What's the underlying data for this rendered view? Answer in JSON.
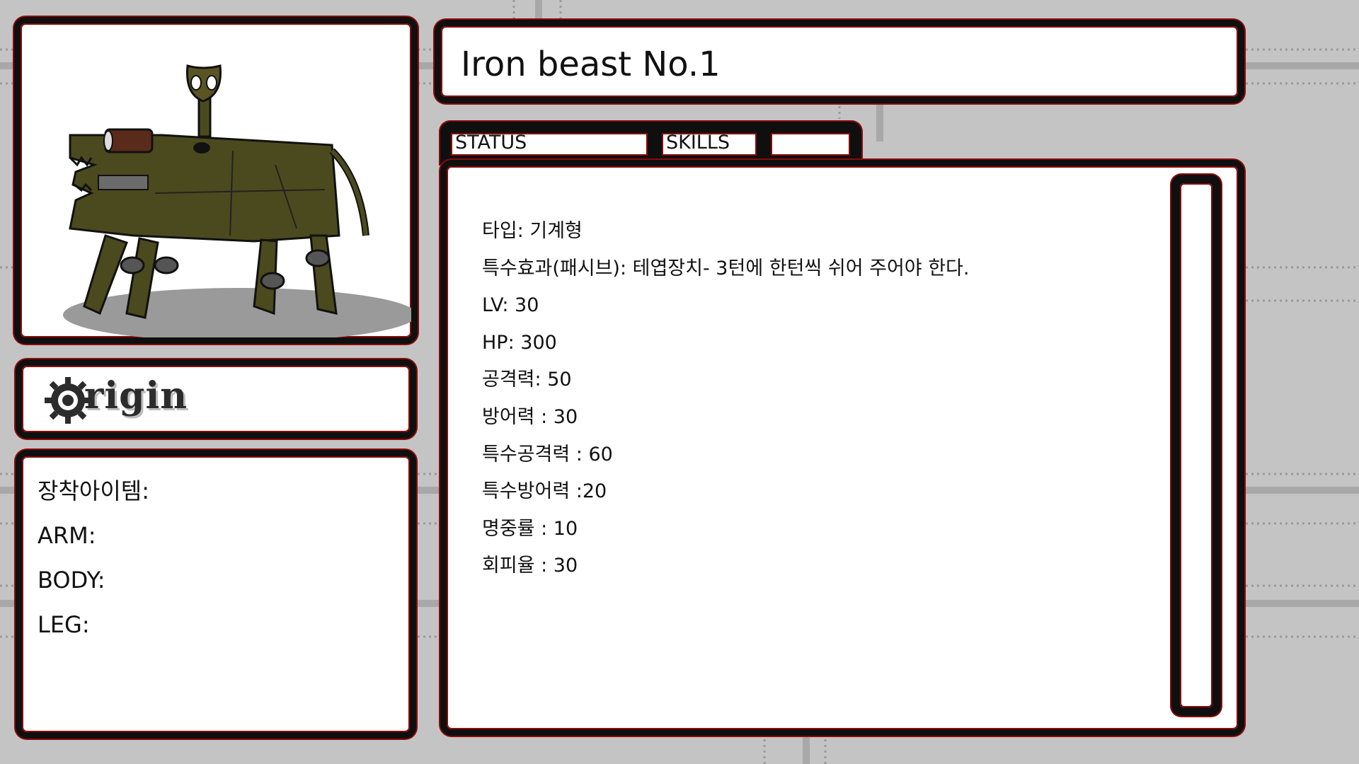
{
  "monster": {
    "name": "Iron beast No.1"
  },
  "tabs": [
    {
      "label": "STATUS"
    },
    {
      "label": "SKILLS"
    },
    {
      "label": ""
    }
  ],
  "stats": [
    "타입: 기계형",
    "특수효과(패시브): 테엽장치- 3턴에 한턴씩 쉬어 주어야 한다.",
    "LV: 30",
    "HP: 300",
    "공격력: 50",
    "방어력 : 30",
    "특수공격력 : 60",
    "특수방어력 :20",
    "명중률 : 10",
    "회피율 : 30"
  ],
  "equipment": {
    "heading": "장착아이템:",
    "slots": [
      "ARM:",
      "BODY:",
      "LEG:"
    ]
  },
  "logo": {
    "text": "rigin"
  },
  "colors": {
    "background": "#c4c4c4",
    "panel_border": "#0f0f0f",
    "panel_accent": "#8b0a0a",
    "creature_body": "#4b4a1e"
  },
  "icons": [
    "gear-icon",
    "iron-beast-portrait"
  ]
}
